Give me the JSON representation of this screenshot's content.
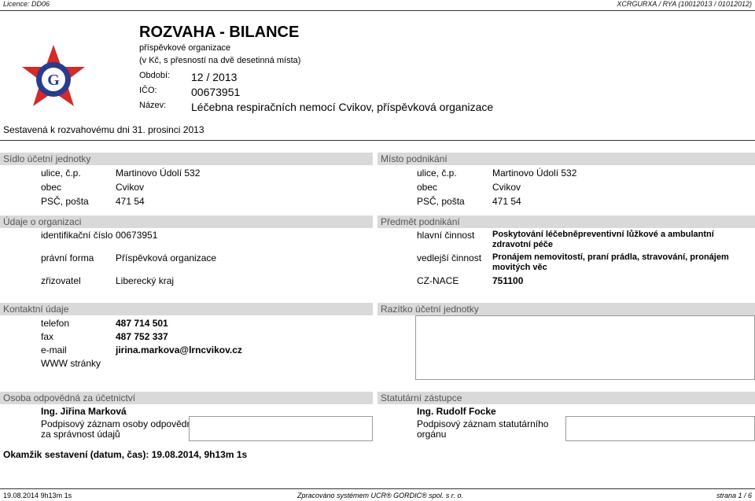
{
  "topbar": {
    "license": "Licence: DD06",
    "right": "XCRGURXA / RYA  (10012013 / 01012012)"
  },
  "header": {
    "title": "ROZVAHA - BILANCE",
    "subtitle": "příspěvkové organizace",
    "note": "(v Kč, s přesností na dvě desetinná místa)",
    "period_label": "Období:",
    "period_value": "12 / 2013",
    "ico_label": "IČO:",
    "ico_value": "00673951",
    "name_label": "Název:",
    "name_value": "Léčebna respiračních nemocí Cvikov, příspěvková organizace",
    "logo_letter": "G"
  },
  "compiled": "Sestavená k rozvahovému dni 31. prosinci 2013",
  "seat": {
    "title": "Sídlo účetní jednotky",
    "street_label": "ulice, č.p.",
    "street": "Martinovo Údolí 532",
    "city_label": "obec",
    "city": "Cvikov",
    "zip_label": "PSČ, pošta",
    "zip": "471 54"
  },
  "business_place": {
    "title": "Místo podnikání",
    "street_label": "ulice, č.p.",
    "street": "Martinovo Údolí 532",
    "city_label": "obec",
    "city": "Cvikov",
    "zip_label": "PSČ, pošta",
    "zip": "471 54"
  },
  "org": {
    "title": "Údaje o organizaci",
    "id_label": "identifikační číslo",
    "id": "00673951",
    "form_label": "právní forma",
    "form": "Příspěvková organizace",
    "founder_label": "zřizovatel",
    "founder": "Liberecký kraj"
  },
  "activity": {
    "title": "Předmět podnikání",
    "main_label": "hlavní činnost",
    "main_1": "Poskytování léčebněpreventivní lůžkové a ambulantní",
    "main_2": "zdravotní péče",
    "side_label": "vedlejší činnost",
    "side_1": "Pronájem nemovitostí, praní prádla, stravování, pronájem",
    "side_2": "movitých věc",
    "nace_label": "CZ-NACE",
    "nace": "751100"
  },
  "contact": {
    "title": "Kontaktní údaje",
    "phone_label": "telefon",
    "phone": "487 714 501",
    "fax_label": "fax",
    "fax": "487 752 337",
    "email_label": "e-mail",
    "email": "jirina.markova@lrncvikov.cz",
    "web_label": "WWW stránky"
  },
  "stamp": {
    "title": "Razítko účetní jednotky"
  },
  "accountant": {
    "title": "Osoba odpovědná za účetnictví",
    "name": "Ing. Jiřina Marková",
    "sig_1": "Podpisový záznam osoby odpovědné",
    "sig_2": "za správnost údajů"
  },
  "statutory": {
    "title": "Statutární zástupce",
    "name": "Ing. Rudolf Focke",
    "sig_1": "Podpisový záznam statutárního",
    "sig_2": "orgánu"
  },
  "moment": "Okamžik sestavení (datum, čas): 19.08.2014, 9h13m 1s",
  "footer": {
    "left": "19.08.2014 9h13m 1s",
    "center": "Zpracováno systémem  UCR® GORDIC® spol. s  r. o.",
    "right": "strana 1 / 6"
  },
  "colors": {
    "section_bg": "#d9d9d9",
    "logo_red": "#d42a2a",
    "logo_blue": "#2a3a8c"
  }
}
